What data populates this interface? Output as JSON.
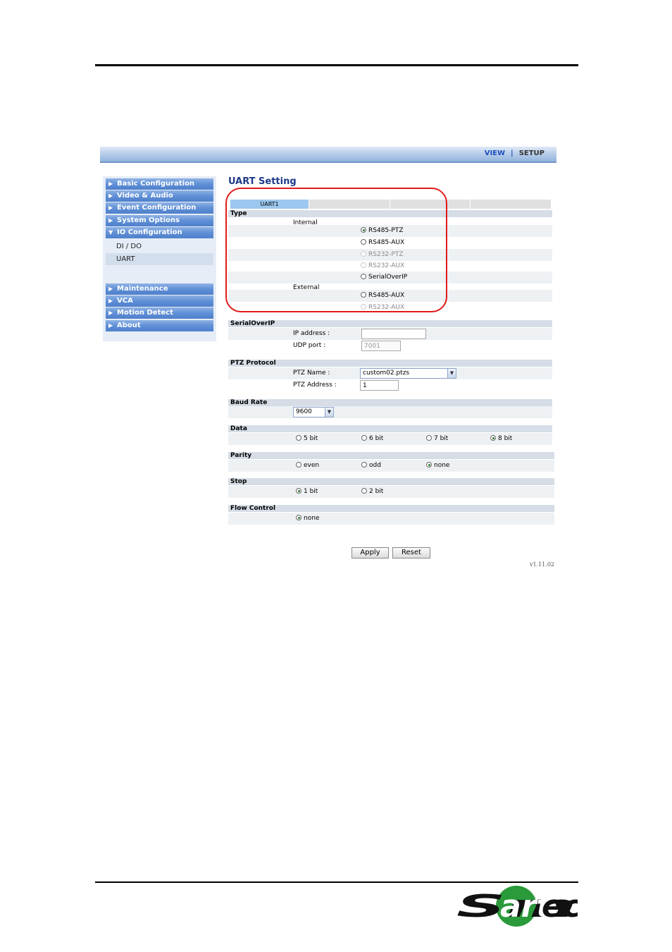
{
  "topbar": {
    "view": "VIEW",
    "separator": "|",
    "setup": "SETUP"
  },
  "sidebar": {
    "items": [
      {
        "label": "Basic Configuration",
        "arrow": "▶"
      },
      {
        "label": "Video & Audio",
        "arrow": "▶"
      },
      {
        "label": "Event Configuration",
        "arrow": "▶"
      },
      {
        "label": "System Options",
        "arrow": "▶"
      },
      {
        "label": "IO Configuration",
        "arrow": "▼"
      },
      {
        "label": "Maintenance",
        "arrow": "▶"
      },
      {
        "label": "VCA",
        "arrow": "▶"
      },
      {
        "label": "Motion Detect",
        "arrow": "▶"
      },
      {
        "label": "About",
        "arrow": "▶"
      }
    ],
    "subitems": [
      {
        "label": "DI / DO"
      },
      {
        "label": "UART"
      }
    ]
  },
  "main": {
    "title": "UART Setting",
    "tabs": [
      "UART1"
    ],
    "type": {
      "heading": "Type",
      "internal_label": "Internal",
      "external_label": "External",
      "internal_options": [
        "RS485-PTZ",
        "RS485-AUX",
        "RS232-PTZ",
        "RS232-AUX",
        "SerialOverIP"
      ],
      "external_options": [
        "RS485-AUX",
        "RS232-AUX"
      ],
      "selected": "RS485-PTZ"
    },
    "serial_over_ip": {
      "heading": "SerialOverIP",
      "ip_label": "IP address :",
      "ip_value": "",
      "udp_label": "UDP port :",
      "udp_value": "7001"
    },
    "ptz_protocol": {
      "heading": "PTZ Protocol",
      "name_label": "PTZ Name :",
      "name_value": "custom02.ptzs",
      "address_label": "PTZ Address :",
      "address_value": "1"
    },
    "baud_rate": {
      "heading": "Baud Rate",
      "value": "9600"
    },
    "data": {
      "heading": "Data",
      "options": [
        "5 bit",
        "6 bit",
        "7 bit",
        "8 bit"
      ],
      "selected": "8 bit"
    },
    "parity": {
      "heading": "Parity",
      "options": [
        "even",
        "odd",
        "none"
      ],
      "selected": "none"
    },
    "stop": {
      "heading": "Stop",
      "options": [
        "1 bit",
        "2 bit"
      ],
      "selected": "1 bit"
    },
    "flow_control": {
      "heading": "Flow Control",
      "options": [
        "none"
      ],
      "selected": "none"
    },
    "apply_label": "Apply",
    "reset_label": "Reset",
    "version": "v1.11.02"
  },
  "logo": {
    "text": "Smartec",
    "color": "#2a9a3a"
  },
  "colors": {
    "highlight": "#e11a1a",
    "menu": "#5f8fd6",
    "title": "#1e3a8a"
  }
}
